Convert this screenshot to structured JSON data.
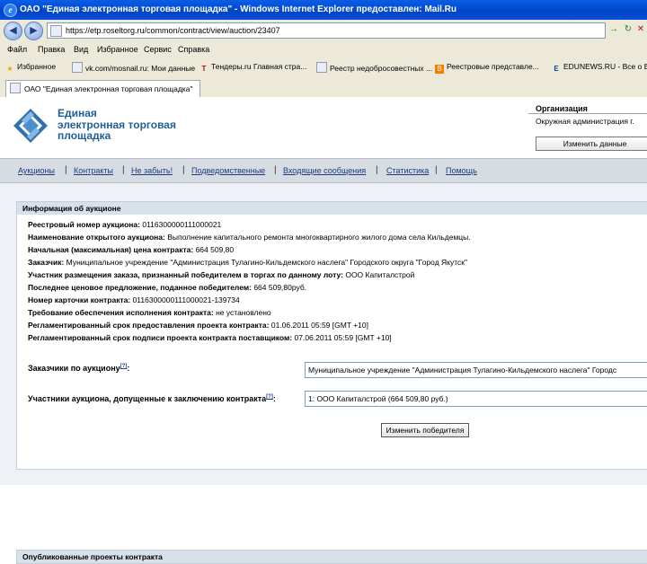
{
  "window": {
    "title": "ОАО \"Единая электронная торговая площадка\" - Windows Internet Explorer предоставлен: Mail.Ru"
  },
  "address": {
    "url": "https://etp.roseltorg.ru/common/contract/view/auction/23407"
  },
  "menu": [
    "Файл",
    "Правка",
    "Вид",
    "Избранное",
    "Сервис",
    "Справка"
  ],
  "favorites": [
    {
      "label": "Избранное",
      "icon": "star-icon"
    },
    {
      "label": "vk.com/mosnail.ru: Мои данные",
      "icon": "page-icon"
    },
    {
      "label": "Тендеры.ru Главная стра...",
      "icon": "tender-icon"
    },
    {
      "label": "Реестр недобросовестных ...",
      "icon": "page-icon"
    },
    {
      "label": "Реестровые представле...",
      "icon": "blogger-icon"
    },
    {
      "label": "EDUNEWS.RU - Все о ВУЗах",
      "icon": "edu-icon"
    }
  ],
  "tab": {
    "label": "ОАО \"Единая электронная торговая площадка\""
  },
  "brand": {
    "line1": "Единая",
    "line2": "электронная торговая",
    "line3": "площадка"
  },
  "org": {
    "label": "Организация",
    "name": "Окружная администрация г.",
    "button": "Изменить данные"
  },
  "nav": [
    "Аукционы",
    "Контракты",
    "Не забыть!",
    "Подведомственные",
    "Входящие сообщения",
    "Статистика",
    "Помощь"
  ],
  "panel": {
    "title": "Информация об аукционе",
    "rows": [
      {
        "label": "Реестровый номер аукциона:",
        "value": "0116300000111000021"
      },
      {
        "label": "Наименование открытого аукциона:",
        "value": "Выполнение капитального ремонта многоквартирного жилого дома села Кильдемцы."
      },
      {
        "label": "Начальная (максимальная) цена контракта:",
        "value": "664 509,80"
      },
      {
        "label": "Заказчик:",
        "value": "Муниципальное учреждение \"Администрация Тулагино-Кильдемского наслега\" Городского округа \"Город Якутск\""
      },
      {
        "label": "Участник размещения заказа, признанный победителем в торгах по данному лоту:",
        "value": "ООО Капиталстрой"
      },
      {
        "label": "Последнее ценовое предложение, поданное победителем:",
        "value": "664 509,80руб."
      },
      {
        "label": "Номер карточки контракта:",
        "value": "0116300000111000021-139734"
      },
      {
        "label": "Требование обеспечения исполнения контракта:",
        "value": "не установлено"
      },
      {
        "label": "Регламентированный срок предоставления проекта контракта:",
        "value": "01.06.2011 05:59 [GMT +10]"
      },
      {
        "label": "Регламентированный срок подписи проекта контракта поставщиком:",
        "value": "07.06.2011 05:59 [GMT +10]"
      }
    ],
    "customers_label": "Заказчики по аукциону",
    "customers_value": "Муниципальное учреждение \"Администрация Тулагино-Кильдемского наслега\" Городс",
    "participants_label": "Участники аукциона, допущенные к заключению контракта",
    "participants_value": "1: ООО Капиталстрой (664 509,80 руб.)",
    "help_mark": "[?]",
    "change_winner_button": "Изменить победителя"
  },
  "panel2": {
    "title": "Опубликованные проекты контракта"
  }
}
